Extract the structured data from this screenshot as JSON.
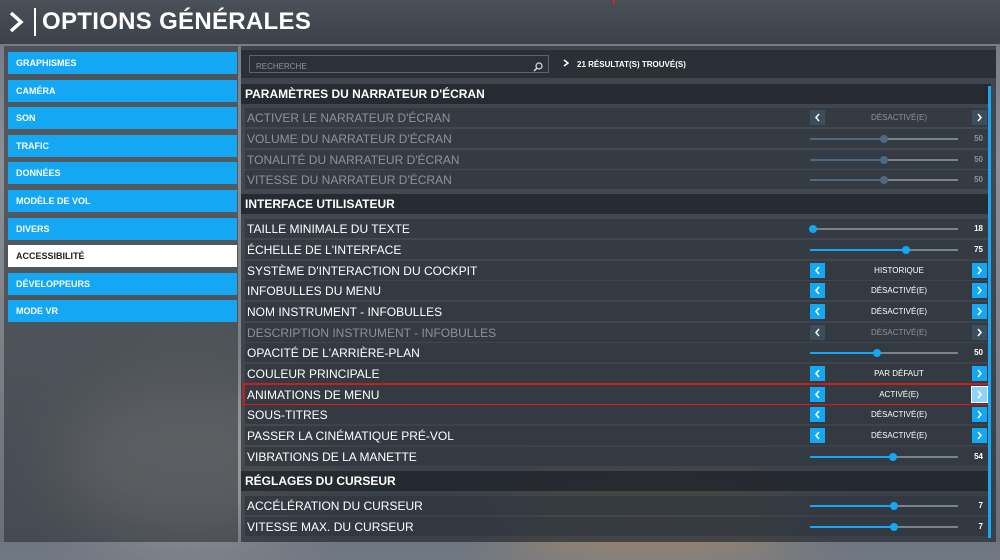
{
  "header": {
    "title": "OPTIONS GÉNÉRALES"
  },
  "colors": {
    "accent": "#14a7f4",
    "highlight": "#c81e1e",
    "active_item_bg": "#ffffff"
  },
  "sidebar": {
    "items": [
      {
        "label": "GRAPHISMES"
      },
      {
        "label": "CAMÉRA"
      },
      {
        "label": "SON"
      },
      {
        "label": "TRAFIC"
      },
      {
        "label": "DONNÉES"
      },
      {
        "label": "MODÈLE DE VOL"
      },
      {
        "label": "DIVERS"
      },
      {
        "label": "ACCESSIBILITÉ",
        "active": true
      },
      {
        "label": "DÉVELOPPEURS"
      },
      {
        "label": "MODE VR"
      }
    ]
  },
  "search": {
    "placeholder": "RECHERCHE",
    "value": "",
    "icon": "search-icon",
    "results": "21 RÉSULTAT(S) TROUVÉ(S)"
  },
  "sections": [
    {
      "title": "PARAMÈTRES DU NARRATEUR D'ÉCRAN",
      "rows": [
        {
          "label": "ACTIVER LE NARRATEUR D'ÉCRAN",
          "type": "option",
          "value": "DÉSACTIVÉ(E)",
          "disabled": true
        },
        {
          "label": "VOLUME DU NARRATEUR D'ÉCRAN",
          "type": "slider",
          "value": 50,
          "max": 100,
          "disabled": true
        },
        {
          "label": "TONALITÉ DU NARRATEUR D'ÉCRAN",
          "type": "slider",
          "value": 50,
          "max": 100,
          "disabled": true
        },
        {
          "label": "VITESSE DU NARRATEUR D'ÉCRAN",
          "type": "slider",
          "value": 50,
          "max": 100,
          "disabled": true
        }
      ]
    },
    {
      "title": "INTERFACE UTILISATEUR",
      "rows": [
        {
          "label": "TAILLE MINIMALE DU TEXTE",
          "type": "slider",
          "value": 18,
          "max": 100,
          "fill": 0.02
        },
        {
          "label": "ÉCHELLE DE L'INTERFACE",
          "type": "slider",
          "value": 75,
          "max": 100,
          "fill": 0.65
        },
        {
          "label": "SYSTÈME D'INTERACTION DU COCKPIT",
          "type": "option",
          "value": "HISTORIQUE"
        },
        {
          "label": "INFOBULLES DU MENU",
          "type": "option",
          "value": "DÉSACTIVÉ(E)"
        },
        {
          "label": "NOM INSTRUMENT - INFOBULLES",
          "type": "option",
          "value": "DÉSACTIVÉ(E)"
        },
        {
          "label": "DESCRIPTION INSTRUMENT - INFOBULLES",
          "type": "option",
          "value": "DÉSACTIVÉ(E)",
          "disabled": true
        },
        {
          "label": "OPACITÉ DE L'ARRIÈRE-PLAN",
          "type": "slider",
          "value": 50,
          "max": 100,
          "fill": 0.45
        },
        {
          "label": "COULEUR PRINCIPALE",
          "type": "option",
          "value": "PAR DÉFAUT"
        },
        {
          "label": "ANIMATIONS DE MENU",
          "type": "option",
          "value": "ACTIVÉ(E)",
          "highlight": true
        },
        {
          "label": "SOUS-TITRES",
          "type": "option",
          "value": "DÉSACTIVÉ(E)"
        },
        {
          "label": "PASSER LA CINÉMATIQUE PRÉ-VOL",
          "type": "option",
          "value": "DÉSACTIVÉ(E)"
        },
        {
          "label": "VIBRATIONS DE LA MANETTE",
          "type": "slider",
          "value": 54,
          "max": 100,
          "fill": 0.56
        }
      ]
    },
    {
      "title": "RÉGLAGES DU CURSEUR",
      "rows": [
        {
          "label": "ACCÉLÉRATION DU CURSEUR",
          "type": "slider",
          "value": 7,
          "max": 10,
          "fill": 0.57
        },
        {
          "label": "VITESSE MAX. DU CURSEUR",
          "type": "slider",
          "value": 7,
          "max": 10,
          "fill": 0.57
        }
      ]
    }
  ]
}
